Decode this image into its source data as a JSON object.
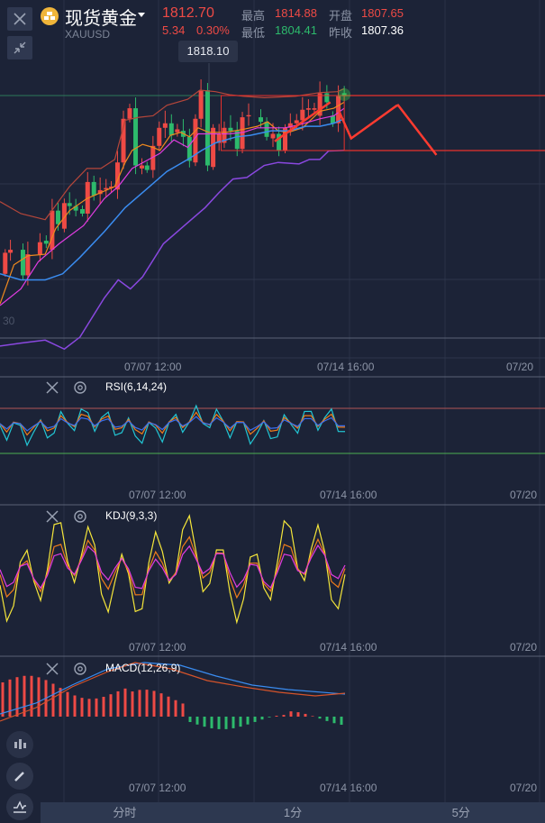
{
  "header": {
    "title": "现货黄金",
    "symbol": "XAUUSD",
    "price": "1812.70",
    "change": "5.34",
    "change_pct": "0.30%",
    "high_label": "最高",
    "high": "1814.88",
    "open_label": "开盘",
    "open": "1807.65",
    "low_label": "最低",
    "low": "1804.41",
    "prev_close_label": "昨收",
    "prev_close": "1807.36"
  },
  "crosshair_price": "1818.10",
  "main_axis_label": "30",
  "time_labels": [
    "07/07 12:00",
    "07/14 16:00",
    "07/20"
  ],
  "indicators": {
    "rsi": "RSI(6,14,24)",
    "kdj": "KDJ(9,3,3)",
    "macd": "MACD(12,26,9)"
  },
  "tabs": [
    "分时",
    "1分",
    "5分"
  ],
  "colors": {
    "up": "#ee4a45",
    "down": "#2dba6c",
    "bg": "#1c2337"
  }
}
